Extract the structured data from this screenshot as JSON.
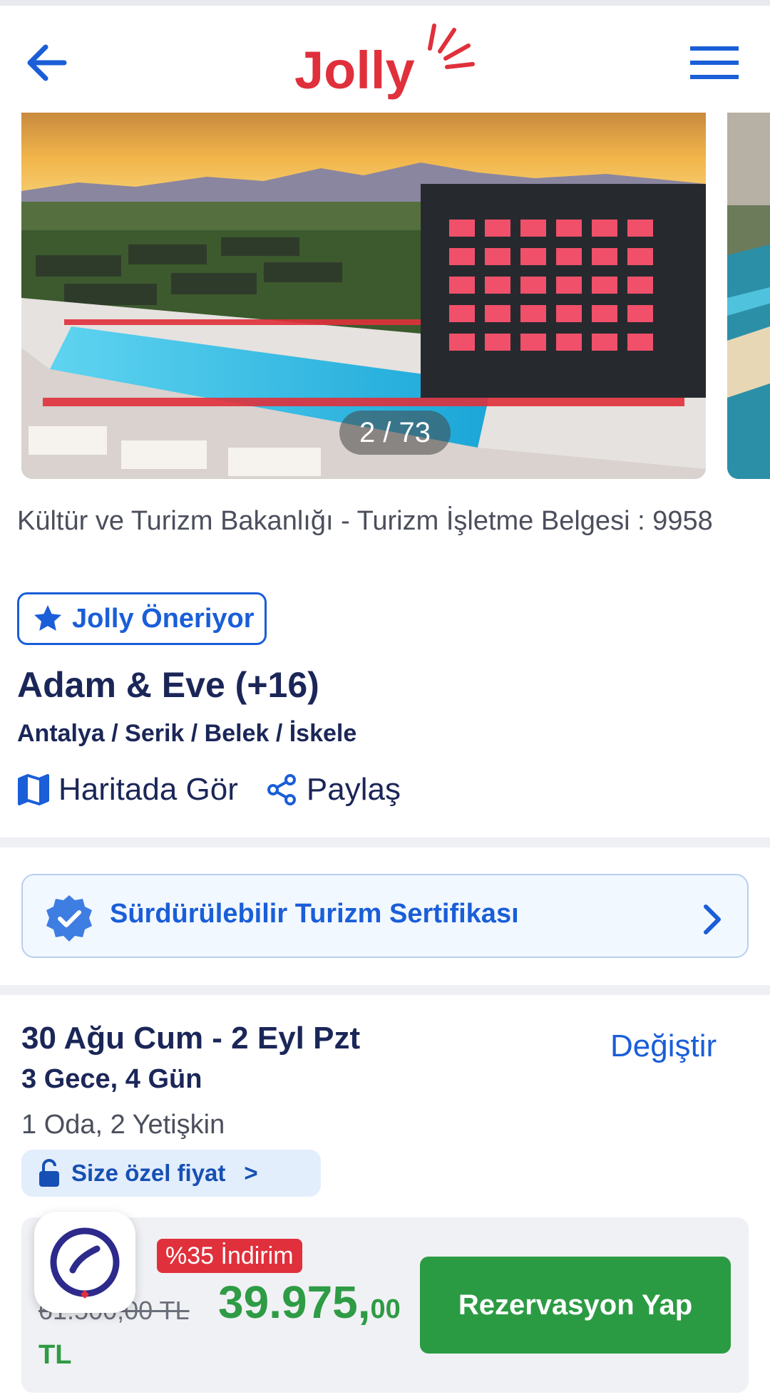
{
  "header": {
    "logo_text": "Jolly",
    "back_icon": "arrow-left-icon",
    "menu_icon": "hamburger-menu-icon"
  },
  "gallery": {
    "counter": "2 / 73"
  },
  "hotel": {
    "license": "Kültür ve Turizm Bakanlığı - Turizm İşletme Belgesi : 9958",
    "badge": "Jolly Öneriyor",
    "name": "Adam & Eve (+16)",
    "location": "Antalya / Serik / Belek / İskele",
    "map_label": "Haritada Gör",
    "share_label": "Paylaş"
  },
  "certificate": {
    "label": "Sürdürülebilir Turizm Sertifikası"
  },
  "booking": {
    "dates": "30 Ağu Cum - 2 Eyl Pzt",
    "nights": "3 Gece, 4 Gün",
    "change_label": "Değiştir",
    "rooms": "1 Oda, 2 Yetişkin",
    "special_price": "Size özel fiyat",
    "special_arrow": ">"
  },
  "price": {
    "discount": "%35 İndirim",
    "old_price": "61.500,00 TL",
    "new_price_main": "39.975,",
    "new_price_decimals": "00",
    "currency": "TL",
    "reserve_label": "Rezervasyon Yap"
  },
  "colors": {
    "brand_red": "#e0303b",
    "accent_blue": "#1a5ed8",
    "price_green": "#2e9b45",
    "navy": "#1b2658"
  }
}
